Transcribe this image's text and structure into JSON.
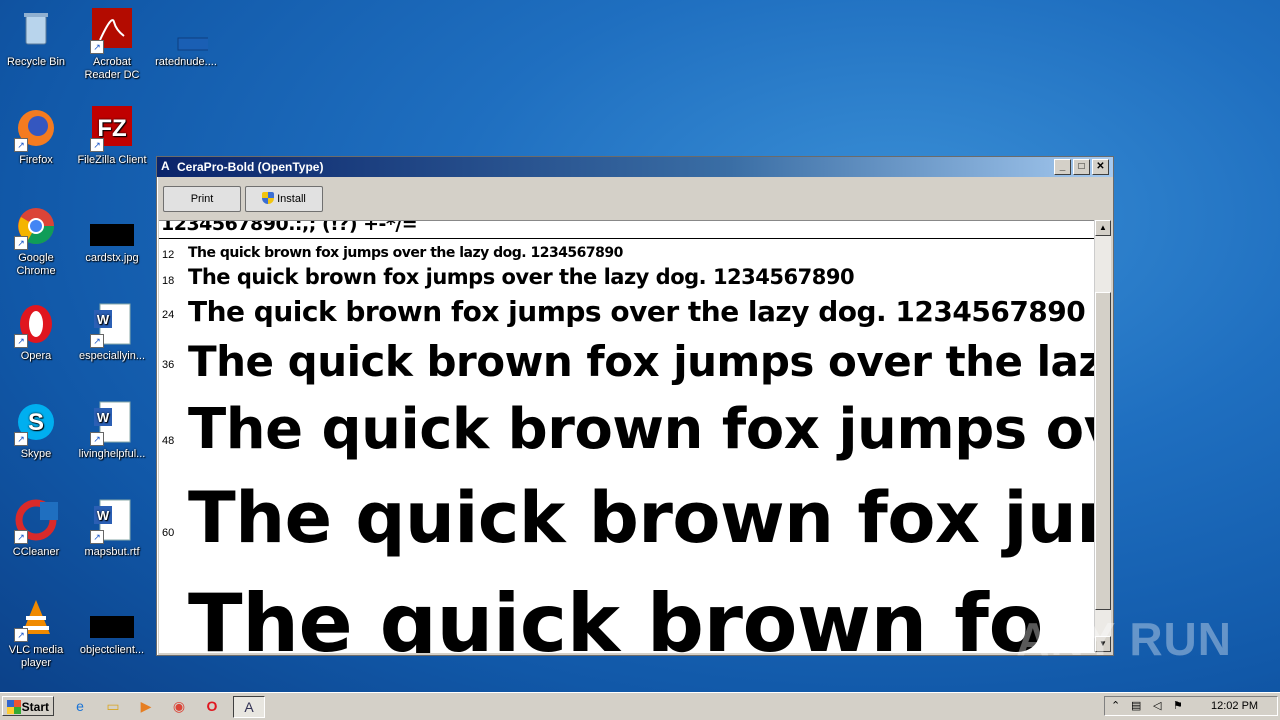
{
  "desktop": {
    "icons": [
      {
        "label": "Recycle Bin",
        "icon": "recycle-bin-icon"
      },
      {
        "label": "Acrobat Reader DC",
        "icon": "acrobat-icon"
      },
      {
        "label": "ratednude....",
        "icon": "file-icon"
      },
      {
        "label": "Firefox",
        "icon": "firefox-icon"
      },
      {
        "label": "FileZilla Client",
        "icon": "filezilla-icon"
      },
      {
        "label": "Google Chrome",
        "icon": "chrome-icon"
      },
      {
        "label": "cardstx.jpg",
        "icon": "image-file-icon"
      },
      {
        "label": "Opera",
        "icon": "opera-icon"
      },
      {
        "label": "especiallyin...",
        "icon": "word-doc-icon"
      },
      {
        "label": "Skype",
        "icon": "skype-icon"
      },
      {
        "label": "livinghelpful...",
        "icon": "word-doc-icon"
      },
      {
        "label": "CCleaner",
        "icon": "ccleaner-icon"
      },
      {
        "label": "mapsbut.rtf",
        "icon": "word-doc-icon"
      },
      {
        "label": "VLC media player",
        "icon": "vlc-icon"
      },
      {
        "label": "objectclient...",
        "icon": "image-file-icon"
      }
    ]
  },
  "window": {
    "title": "CeraPro-Bold (OpenType)",
    "controls": {
      "minimize": "_",
      "maximize": "□",
      "close": "✕"
    },
    "toolbar": {
      "print_label": "Print",
      "install_label": "Install"
    },
    "header_partial": "1234567890.:,;      (!?) +-*/=",
    "samples": [
      {
        "size": "12",
        "text": "The quick brown fox jumps over the lazy dog. 1234567890"
      },
      {
        "size": "18",
        "text": "The quick brown fox jumps over the lazy dog. 1234567890"
      },
      {
        "size": "24",
        "text": "The quick brown fox jumps over the lazy dog. 1234567890"
      },
      {
        "size": "36",
        "text": "The quick brown fox jumps over the lazy"
      },
      {
        "size": "48",
        "text": "The quick brown fox jumps ov"
      },
      {
        "size": "60",
        "text": "The quick brown fox jum"
      },
      {
        "size": "",
        "text": "The quick brown fo"
      }
    ]
  },
  "taskbar": {
    "start_label": "Start",
    "clock": "12:02 PM"
  },
  "watermark": "ANY RUN"
}
